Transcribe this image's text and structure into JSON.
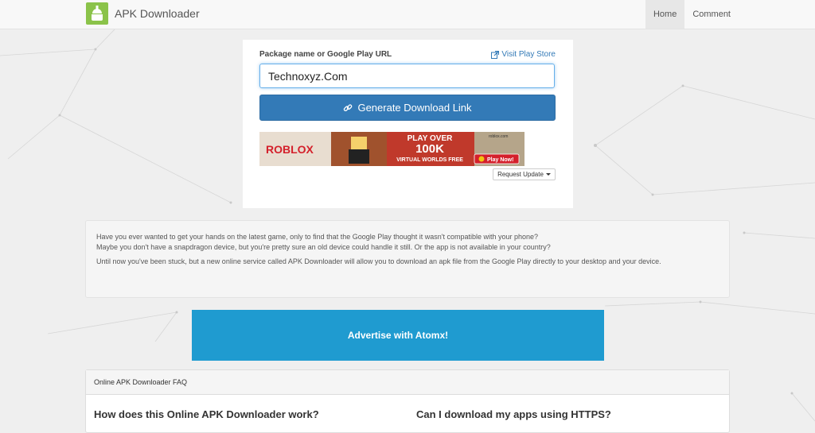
{
  "navbar": {
    "brand": "APK Downloader",
    "logo_icon": "android-download-icon",
    "items": [
      {
        "label": "Home",
        "active": true
      },
      {
        "label": "Comment",
        "active": false
      }
    ]
  },
  "form": {
    "label": "Package name or Google Play URL",
    "visit_link": "Visit Play Store",
    "input_value": "Technoxyz.Com",
    "button_label": "Generate Download Link",
    "request_update": "Request Update"
  },
  "ad": {
    "brand": "ROBLOX",
    "line1": "PLAY OVER",
    "line2": "100K",
    "line3": "VIRTUAL WORLDS FREE",
    "cta": "Play Now!",
    "site": "roblox.com"
  },
  "intro": {
    "p1_line1": "Have you ever wanted to get your hands on the latest game, only to find that the Google Play thought it wasn't compatible with your phone?",
    "p1_line2": "Maybe you don't have a snapdragon device, but you're pretty sure an old device could handle it still. Or the app is not available in your country?",
    "p2": "Until now you've been stuck, but a new online service called APK Downloader will allow you to download an apk file from the Google Play directly to your desktop and your device."
  },
  "advertise": {
    "label": "Advertise with Atomx!"
  },
  "faq": {
    "heading": "Online APK Downloader FAQ",
    "q1": "How does this Online APK Downloader work?",
    "q2": "Can I download my apps using HTTPS?"
  },
  "colors": {
    "primary": "#337ab7",
    "advert": "#1f9bd0",
    "logo": "#8bc34a"
  }
}
